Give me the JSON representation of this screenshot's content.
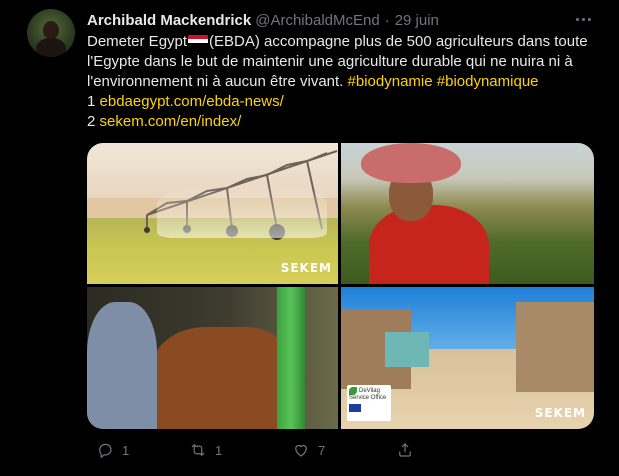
{
  "author": {
    "name": "Archibald Mackendrick",
    "handle": "@ArchibaldMcEnd",
    "separator": "·",
    "date": "29 juin"
  },
  "tweet": {
    "line1_before_flag": "Demeter Egypt",
    "line1_after_flag": "(EBDA) accompagne plus de 500 agriculteurs dans toute",
    "line2": "l'Egypte dans le but de maintenir une agriculture durable qui ne nuira ni à",
    "line3_text": "l'environnement ni à aucun être vivant.",
    "hashtag1": "#biodynamie",
    "hashtag2": "#biodynamique",
    "link1_num": "1",
    "link1": "ebdaegypt.com/ebda-news/",
    "link2_num": "2",
    "link2": "sekem.com/en/index/"
  },
  "media": {
    "tile1_logo": "SEKEM",
    "tile4_logo": "SEKEM",
    "devilag_name": "DeVilag",
    "devilag_subtitle": "Service Office"
  },
  "actions": {
    "reply_count": "1",
    "retweet_count": "1",
    "like_count": "7"
  },
  "icons": {
    "more": "more-dots-icon",
    "reply": "reply-icon",
    "retweet": "retweet-icon",
    "like": "heart-icon",
    "share": "share-icon"
  },
  "colors": {
    "background": "#000000",
    "text": "#e7e9ea",
    "muted": "#71767b",
    "accent_links": "#ffd400"
  }
}
